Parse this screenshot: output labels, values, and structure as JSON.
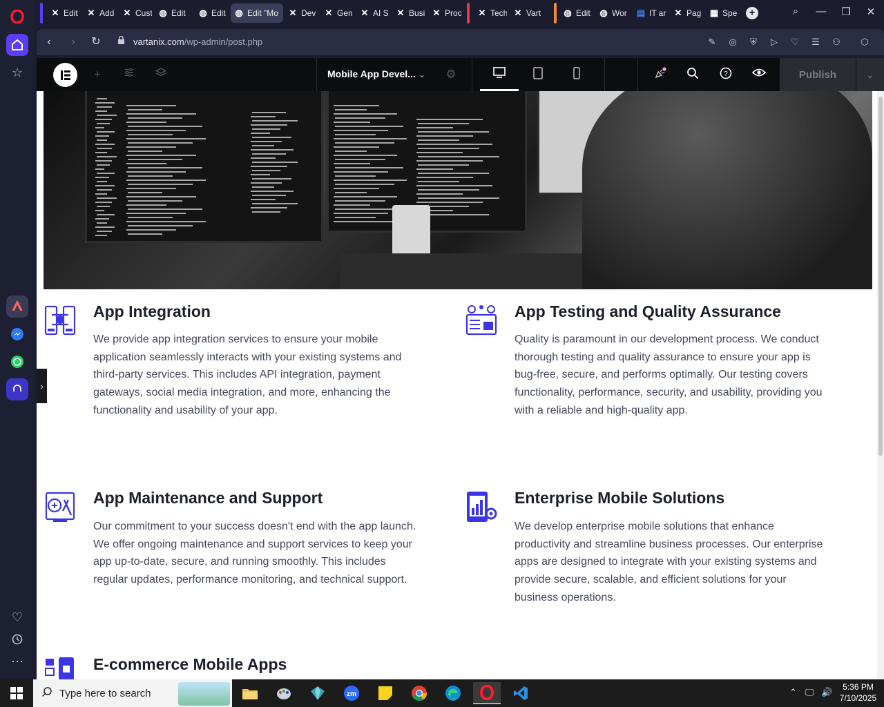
{
  "browser": {
    "tabs": [
      {
        "label": "Edit",
        "icon": "elementor-x-icon"
      },
      {
        "label": "Add",
        "icon": "elementor-x-icon"
      },
      {
        "label": "Cust",
        "icon": "elementor-x-icon"
      },
      {
        "label": "Edit",
        "icon": "globe-icon"
      },
      {
        "label": "Edit",
        "icon": "globe-icon"
      },
      {
        "label": "Edit \"Mo",
        "icon": "globe-icon"
      },
      {
        "label": "Dev",
        "icon": "elementor-x-icon"
      },
      {
        "label": "Gen",
        "icon": "elementor-x-icon"
      },
      {
        "label": "AI S",
        "icon": "elementor-x-icon"
      },
      {
        "label": "Busi",
        "icon": "elementor-x-icon"
      },
      {
        "label": "Proc",
        "icon": "elementor-x-icon"
      },
      {
        "label": "Tech",
        "icon": "elementor-x-icon"
      },
      {
        "label": "Vart",
        "icon": "elementor-x-icon"
      },
      {
        "label": "Edit",
        "icon": "globe-icon"
      },
      {
        "label": "Wor",
        "icon": "globe-icon"
      },
      {
        "label": "IT ar",
        "icon": "doc-icon"
      },
      {
        "label": "Pag",
        "icon": "elementor-x-icon"
      },
      {
        "label": "Spe",
        "icon": "grid-icon"
      }
    ],
    "url_host": "vartanix.com",
    "url_path": "/wp-admin/post.php"
  },
  "editor": {
    "document_title": "Mobile App Devel...",
    "publish_label": "Publish"
  },
  "content": {
    "cards": [
      {
        "title": "App Integration",
        "text": "We provide app integration services to ensure your mobile application seamlessly interacts with your existing systems and third-party services. This includes API integration, payment gateways, social media integration, and more, enhancing the functionality and usability of your app."
      },
      {
        "title": "App Testing and Quality Assurance",
        "text": "Quality is paramount in our development process. We conduct thorough testing and quality assurance to ensure your app is bug-free, secure, and performs optimally. Our testing covers functionality, performance, security, and usability, providing you with a reliable and high-quality app."
      },
      {
        "title": "App Maintenance and Support",
        "text": "Our commitment to your success doesn't end with the app launch. We offer ongoing maintenance and support services to keep your app up-to-date, secure, and running smoothly. This includes regular updates, performance monitoring, and technical support."
      },
      {
        "title": "Enterprise Mobile Solutions",
        "text": "We develop enterprise mobile solutions that enhance productivity and streamline business processes. Our enterprise apps are designed to integrate with your existing systems and provide secure, scalable, and efficient solutions for your business operations."
      },
      {
        "title": "E-commerce Mobile Apps",
        "text": ""
      }
    ]
  },
  "taskbar": {
    "search_placeholder": "Type here to search",
    "time": "5:36 PM",
    "date": "7/10/2025"
  },
  "colors": {
    "accent": "#3b35e6",
    "opera_active": "#5b3df5",
    "heading": "#1c1f2a",
    "body_text": "#44485a"
  }
}
